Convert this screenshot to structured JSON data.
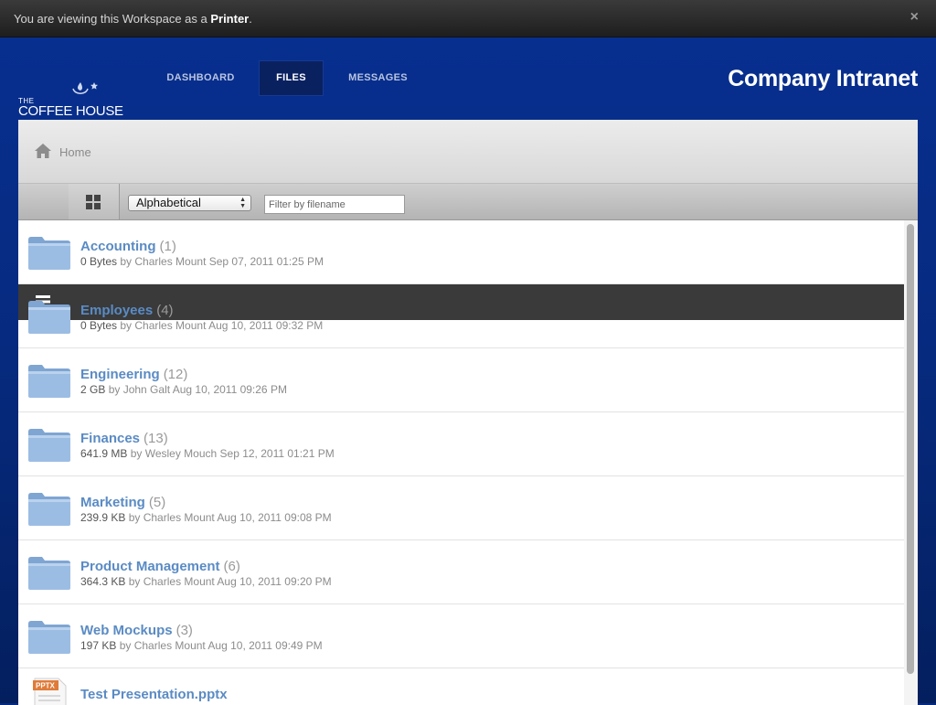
{
  "notice": {
    "message_prefix": "You are viewing this Workspace as a ",
    "role": "Printer",
    "close_symbol": "×"
  },
  "brand": {
    "logo_small": "THE",
    "logo_name": "COFFEE HOUSE",
    "title": "Company Intranet"
  },
  "nav": {
    "items": [
      {
        "label": "DASHBOARD",
        "active": false
      },
      {
        "label": "FILES",
        "active": true
      },
      {
        "label": "MESSAGES",
        "active": false
      }
    ]
  },
  "breadcrumb": {
    "home_label": "Home"
  },
  "toolbar": {
    "sort_selected": "Alphabetical",
    "filter_placeholder": "Filter by filename"
  },
  "files": [
    {
      "name": "Accounting",
      "count": "(1)",
      "size": "0 Bytes",
      "by": " by Charles Mount Sep 07, 2011 01:25 PM",
      "type": "folder"
    },
    {
      "name": "Employees",
      "count": "(4)",
      "size": "0 Bytes",
      "by": " by Charles Mount Aug 10, 2011 09:32 PM",
      "type": "folder"
    },
    {
      "name": "Engineering",
      "count": "(12)",
      "size": "2 GB",
      "by": " by John Galt Aug 10, 2011 09:26 PM",
      "type": "folder"
    },
    {
      "name": "Finances",
      "count": "(13)",
      "size": "641.9 MB",
      "by": " by Wesley Mouch Sep 12, 2011 01:21 PM",
      "type": "folder"
    },
    {
      "name": "Marketing",
      "count": "(5)",
      "size": "239.9 KB",
      "by": " by Charles Mount Aug 10, 2011 09:08 PM",
      "type": "folder"
    },
    {
      "name": "Product Management",
      "count": "(6)",
      "size": "364.3 KB",
      "by": " by Charles Mount Aug 10, 2011 09:20 PM",
      "type": "folder"
    },
    {
      "name": "Web Mockups",
      "count": "(3)",
      "size": "197 KB",
      "by": " by Charles Mount Aug 10, 2011 09:49 PM",
      "type": "folder"
    },
    {
      "name": "Test Presentation.pptx",
      "count": "",
      "size": "",
      "by": "",
      "type": "pptx",
      "badge": "PPTX"
    }
  ],
  "colors": {
    "accent_blue": "#062a7c",
    "link_blue": "#5a8bc4"
  }
}
